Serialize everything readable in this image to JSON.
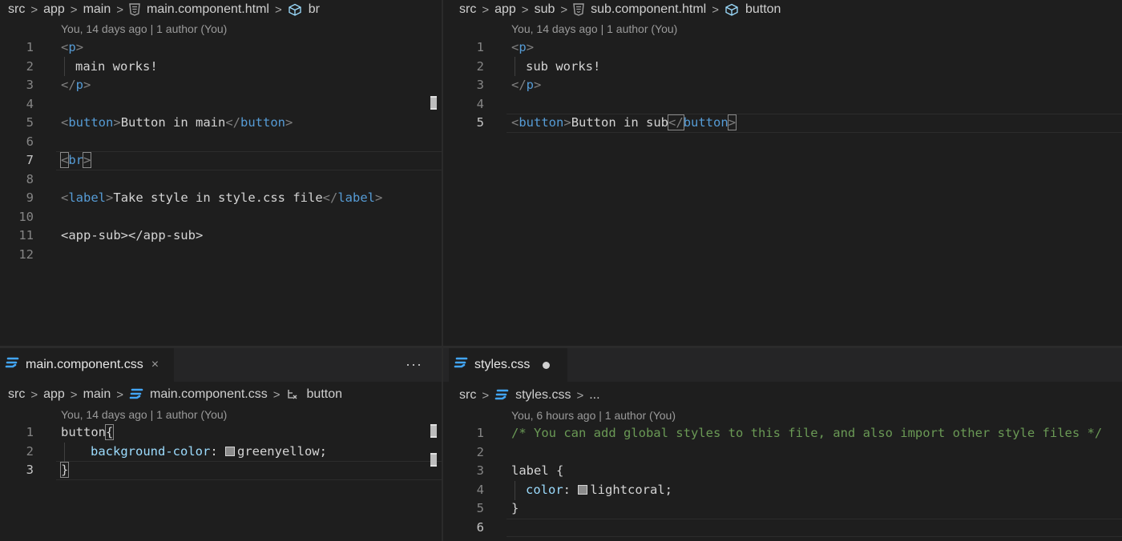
{
  "panes": {
    "main_html": {
      "breadcrumb": [
        "src",
        "app",
        "main",
        "main.component.html",
        "br"
      ],
      "codelens": "You, 14 days ago | 1 author (You)",
      "lines": [
        "1",
        "2",
        "3",
        "4",
        "5",
        "6",
        "7",
        "8",
        "9",
        "10",
        "11",
        "12"
      ],
      "tokens": {
        "p_open_lt": "<",
        "p_name": "p",
        "p_open_gt": ">",
        "main_text": "main works!",
        "p_close_lt": "</",
        "p_close_gt": ">",
        "button_lt": "<",
        "button_name": "button",
        "button_gt": ">",
        "button_text": "Button in main",
        "button_close_lt": "</",
        "button_close_name": "button",
        "button_close_gt": ">",
        "br_lt": "<",
        "br_name": "br",
        "br_gt": ">",
        "label_lt": "<",
        "label_name": "label",
        "label_gt": ">",
        "label_text": "Take style in style.css file",
        "label_close_lt": "</",
        "label_close_name": "label",
        "label_close_gt": ">",
        "appsub": "<app-sub></app-sub>"
      }
    },
    "sub_html": {
      "breadcrumb": [
        "src",
        "app",
        "sub",
        "sub.component.html",
        "button"
      ],
      "codelens": "You, 14 days ago | 1 author (You)",
      "lines": [
        "1",
        "2",
        "3",
        "4",
        "5"
      ],
      "tokens": {
        "p_open_lt": "<",
        "p_name": "p",
        "p_open_gt": ">",
        "sub_text": "sub works!",
        "p_close_lt": "</",
        "p_close_gt": ">",
        "button_lt": "<",
        "button_name": "button",
        "button_gt": ">",
        "button_text": "Button in sub",
        "button_close_lt": "</",
        "button_close_name": "button",
        "button_close_gt": ">"
      }
    },
    "main_css": {
      "tab_label": "main.component.css",
      "tab_close": "×",
      "more": "···",
      "breadcrumb": [
        "src",
        "app",
        "main",
        "main.component.css",
        "button"
      ],
      "codelens": "You, 14 days ago | 1 author (You)",
      "lines": [
        "1",
        "2",
        "3"
      ],
      "tokens": {
        "selector": "button",
        "brace_open": "{",
        "prop": "background-color",
        "colon": ": ",
        "value": "greenyellow",
        "semi": ";",
        "brace_close": "}"
      }
    },
    "styles_css": {
      "tab_label": "styles.css",
      "breadcrumb": [
        "src",
        "styles.css",
        "..."
      ],
      "codelens": "You, 6 hours ago | 1 author (You)",
      "lines": [
        "1",
        "2",
        "3",
        "4",
        "5",
        "6"
      ],
      "tokens": {
        "comment": "/* You can add global styles to this file, and also import other style files */",
        "selector": "label {",
        "prop": "color",
        "colon": ": ",
        "value": "lightcoral",
        "semi": ";",
        "brace_close": "}"
      }
    }
  },
  "colors": {
    "tag": "#569cd6",
    "property": "#9cdcfe",
    "comment": "#6a9955",
    "css_icon": "#42a5f5",
    "html_icon": "#9e9e9e"
  }
}
